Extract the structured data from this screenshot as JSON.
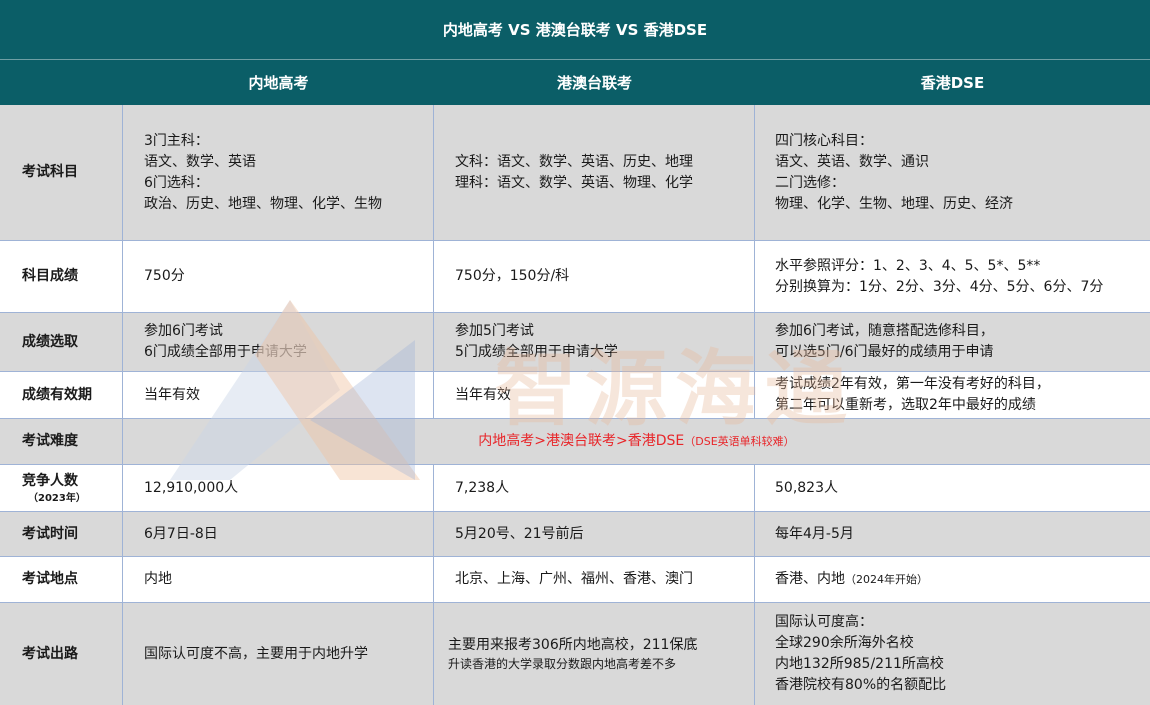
{
  "title": "内地高考 VS 港澳台联考 VS 香港DSE",
  "columns": [
    "内地高考",
    "港澳台联考",
    "香港DSE"
  ],
  "rows": {
    "subjects": {
      "label": "考试科目",
      "c1": [
        "3门主科：",
        "语文、数学、英语",
        "6门选科：",
        "政治、历史、地理、物理、化学、生物"
      ],
      "c2": [
        "文科：语文、数学、英语、历史、地理",
        "理科：语文、数学、英语、物理、化学"
      ],
      "c3": [
        "四门核心科目：",
        "语文、英语、数学、通识",
        "二门选修：",
        "物理、化学、生物、地理、历史、经济"
      ]
    },
    "scores": {
      "label": "科目成绩",
      "c1": "750分",
      "c2": "750分，150分/科",
      "c3": [
        "水平参照评分：1、2、3、4、5、5*、5**",
        "分别换算为：1分、2分、3分、4分、5分、6分、7分"
      ]
    },
    "selection": {
      "label": "成绩选取",
      "c1": [
        "参加6门考试",
        "6门成绩全部用于申请大学"
      ],
      "c2": [
        "参加5门考试",
        "5门成绩全部用于申请大学"
      ],
      "c3": [
        "参加6门考试，随意搭配选修科目，",
        "可以选5门/6门最好的成绩用于申请"
      ]
    },
    "validity": {
      "label": "成绩有效期",
      "c1": "当年有效",
      "c2": "当年有效",
      "c3": [
        "考试成绩2年有效，第一年没有考好的科目，",
        "第二年可以重新考，选取2年中最好的成绩"
      ]
    },
    "difficulty": {
      "label": "考试难度",
      "text": "内地高考>港澳台联考>香港DSE",
      "note": "（DSE英语单科较难）"
    },
    "competitors": {
      "label": "竞争人数",
      "label_sub": "（2023年）",
      "c1": "12,910,000人",
      "c2": "7,238人",
      "c3": "50,823人"
    },
    "time": {
      "label": "考试时间",
      "c1": "6月7日-8日",
      "c2": "5月20号、21号前后",
      "c3": "每年4月-5月"
    },
    "location": {
      "label": "考试地点",
      "c1": "内地",
      "c2": "北京、上海、广州、福州、香港、澳门",
      "c3": "香港、内地",
      "c3_note": "（2024年开始）"
    },
    "outlook": {
      "label": "考试出路",
      "c1": "国际认可度不高，主要用于内地升学",
      "c2": "主要用来报考306所内地高校，211保底",
      "c2_sub": "升读香港的大学录取分数跟内地高考差不多",
      "c3": [
        "国际认可度高：",
        "全球290余所海外名校",
        "内地132所985/211所高校",
        "香港院校有80%的名额配比"
      ]
    }
  },
  "watermark": "智源海通",
  "colors": {
    "header": "#0b5e67",
    "gray_row": "#d9d9d9",
    "accent_red": "#e8262a",
    "border": "#9fb3d6"
  }
}
